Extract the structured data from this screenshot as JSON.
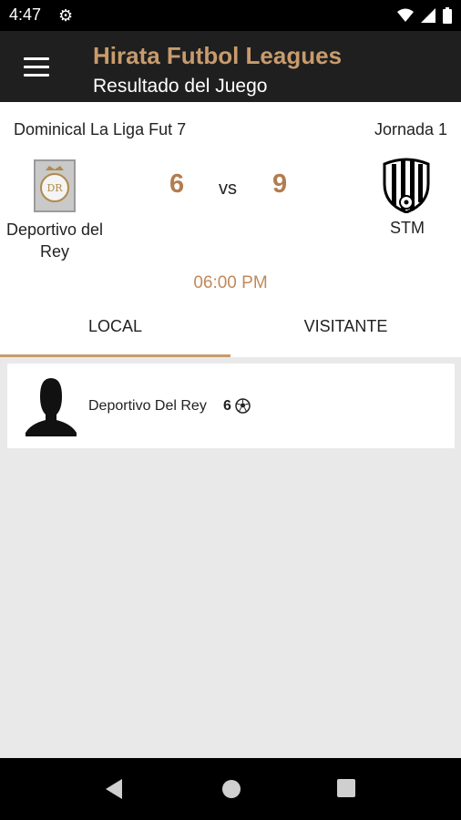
{
  "status_bar": {
    "time": "4:47",
    "icons": [
      "settings-icon",
      "wifi-icon",
      "cellular-signal-icon",
      "battery-icon"
    ]
  },
  "app_bar": {
    "title": "Hirata Futbol Leagues",
    "subtitle": "Resultado del Juego",
    "title_color": "#c89b6d",
    "background": "#1f1f1f"
  },
  "match": {
    "league": "Dominical La Liga Fut 7",
    "round": "Jornada 1",
    "home_team": "Deportivo del Rey",
    "home_logo_text": "DR",
    "home_score": "6",
    "vs_label": "vs",
    "away_score": "9",
    "away_team": "STM",
    "time": "06:00 PM",
    "score_color": "#b27d4f"
  },
  "tabs": [
    {
      "label": "LOCAL",
      "selected": true
    },
    {
      "label": "VISITANTE",
      "selected": false
    }
  ],
  "scorers": [
    {
      "team": "Deportivo Del Rey",
      "goals": "6",
      "icon": "soccer-ball-icon"
    }
  ],
  "nav": [
    "back-icon",
    "home-icon",
    "recents-icon"
  ]
}
